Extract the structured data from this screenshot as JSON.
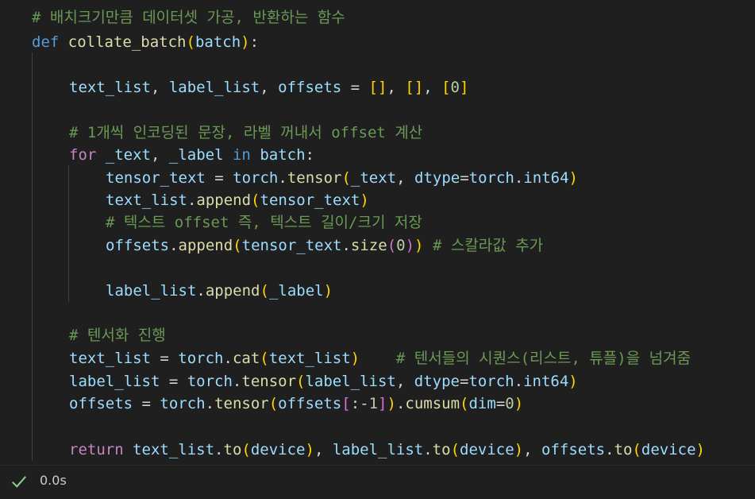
{
  "cell": {
    "lines": [
      [
        [
          "cm",
          "# 배치크기만큼 데이터셋 가공, 반환하는 함수"
        ]
      ],
      [
        [
          "kw",
          "def"
        ],
        [
          "op",
          " "
        ],
        [
          "fn",
          "collate_batch"
        ],
        [
          "p1",
          "("
        ],
        [
          "var",
          "batch"
        ],
        [
          "p1",
          ")"
        ],
        [
          "op",
          ":"
        ]
      ],
      [],
      [
        [
          "var",
          "text_list"
        ],
        [
          "op",
          ", "
        ],
        [
          "var",
          "label_list"
        ],
        [
          "op",
          ", "
        ],
        [
          "var",
          "offsets"
        ],
        [
          "op",
          " = "
        ],
        [
          "p1",
          "[]"
        ],
        [
          "op",
          ", "
        ],
        [
          "p1",
          "[]"
        ],
        [
          "op",
          ", "
        ],
        [
          "p1",
          "["
        ],
        [
          "num",
          "0"
        ],
        [
          "p1",
          "]"
        ]
      ],
      [],
      [
        [
          "cm",
          "# 1개씩 인코딩된 문장, 라벨 꺼내서 offset 계산"
        ]
      ],
      [
        [
          "kw2",
          "for"
        ],
        [
          "op",
          " "
        ],
        [
          "var",
          "_text"
        ],
        [
          "op",
          ", "
        ],
        [
          "var",
          "_label"
        ],
        [
          "op",
          " "
        ],
        [
          "kw",
          "in"
        ],
        [
          "op",
          " "
        ],
        [
          "var",
          "batch"
        ],
        [
          "op",
          ":"
        ]
      ],
      [
        [
          "var",
          "tensor_text"
        ],
        [
          "op",
          " = "
        ],
        [
          "var",
          "torch"
        ],
        [
          "op",
          "."
        ],
        [
          "fn",
          "tensor"
        ],
        [
          "p1",
          "("
        ],
        [
          "var",
          "_text"
        ],
        [
          "op",
          ", "
        ],
        [
          "var",
          "dtype"
        ],
        [
          "op",
          "="
        ],
        [
          "var",
          "torch"
        ],
        [
          "op",
          "."
        ],
        [
          "var",
          "int64"
        ],
        [
          "p1",
          ")"
        ]
      ],
      [
        [
          "var",
          "text_list"
        ],
        [
          "op",
          "."
        ],
        [
          "fn",
          "append"
        ],
        [
          "p1",
          "("
        ],
        [
          "var",
          "tensor_text"
        ],
        [
          "p1",
          ")"
        ]
      ],
      [
        [
          "cm",
          "# 텍스트 offset 즉, 텍스트 길이/크기 저장"
        ]
      ],
      [
        [
          "var",
          "offsets"
        ],
        [
          "op",
          "."
        ],
        [
          "fn",
          "append"
        ],
        [
          "p1",
          "("
        ],
        [
          "var",
          "tensor_text"
        ],
        [
          "op",
          "."
        ],
        [
          "fn",
          "size"
        ],
        [
          "p2",
          "("
        ],
        [
          "num",
          "0"
        ],
        [
          "p2",
          ")"
        ],
        [
          "p1",
          ")"
        ],
        [
          "op",
          " "
        ],
        [
          "cm",
          "# 스칼라값 추가"
        ]
      ],
      [],
      [
        [
          "var",
          "label_list"
        ],
        [
          "op",
          "."
        ],
        [
          "fn",
          "append"
        ],
        [
          "p1",
          "("
        ],
        [
          "var",
          "_label"
        ],
        [
          "p1",
          ")"
        ]
      ],
      [],
      [
        [
          "cm",
          "# 텐서화 진행"
        ]
      ],
      [
        [
          "var",
          "text_list"
        ],
        [
          "op",
          " = "
        ],
        [
          "var",
          "torch"
        ],
        [
          "op",
          "."
        ],
        [
          "fn",
          "cat"
        ],
        [
          "p1",
          "("
        ],
        [
          "var",
          "text_list"
        ],
        [
          "p1",
          ")"
        ],
        [
          "op",
          "    "
        ],
        [
          "cm",
          "# 텐서들의 시퀀스(리스트, 튜플)을 넘겨줌"
        ]
      ],
      [
        [
          "var",
          "label_list"
        ],
        [
          "op",
          " = "
        ],
        [
          "var",
          "torch"
        ],
        [
          "op",
          "."
        ],
        [
          "fn",
          "tensor"
        ],
        [
          "p1",
          "("
        ],
        [
          "var",
          "label_list"
        ],
        [
          "op",
          ", "
        ],
        [
          "var",
          "dtype"
        ],
        [
          "op",
          "="
        ],
        [
          "var",
          "torch"
        ],
        [
          "op",
          "."
        ],
        [
          "var",
          "int64"
        ],
        [
          "p1",
          ")"
        ]
      ],
      [
        [
          "var",
          "offsets"
        ],
        [
          "op",
          " = "
        ],
        [
          "var",
          "torch"
        ],
        [
          "op",
          "."
        ],
        [
          "fn",
          "tensor"
        ],
        [
          "p1",
          "("
        ],
        [
          "var",
          "offsets"
        ],
        [
          "p2",
          "["
        ],
        [
          "op",
          ":-"
        ],
        [
          "num",
          "1"
        ],
        [
          "p2",
          "]"
        ],
        [
          "p1",
          ")"
        ],
        [
          "op",
          "."
        ],
        [
          "fn",
          "cumsum"
        ],
        [
          "p1",
          "("
        ],
        [
          "var",
          "dim"
        ],
        [
          "op",
          "="
        ],
        [
          "num",
          "0"
        ],
        [
          "p1",
          ")"
        ]
      ],
      [],
      [
        [
          "kw2",
          "return"
        ],
        [
          "op",
          " "
        ],
        [
          "var",
          "text_list"
        ],
        [
          "op",
          "."
        ],
        [
          "fn",
          "to"
        ],
        [
          "p1",
          "("
        ],
        [
          "var",
          "device"
        ],
        [
          "p1",
          ")"
        ],
        [
          "op",
          ", "
        ],
        [
          "var",
          "label_list"
        ],
        [
          "op",
          "."
        ],
        [
          "fn",
          "to"
        ],
        [
          "p1",
          "("
        ],
        [
          "var",
          "device"
        ],
        [
          "p1",
          ")"
        ],
        [
          "op",
          ", "
        ],
        [
          "var",
          "offsets"
        ],
        [
          "op",
          "."
        ],
        [
          "fn",
          "to"
        ],
        [
          "p1",
          "("
        ],
        [
          "var",
          "device"
        ],
        [
          "p1",
          ")"
        ]
      ]
    ]
  },
  "status": {
    "icon": "checkmark-icon",
    "success_color": "#89d185",
    "exec_time": "0.0s"
  }
}
